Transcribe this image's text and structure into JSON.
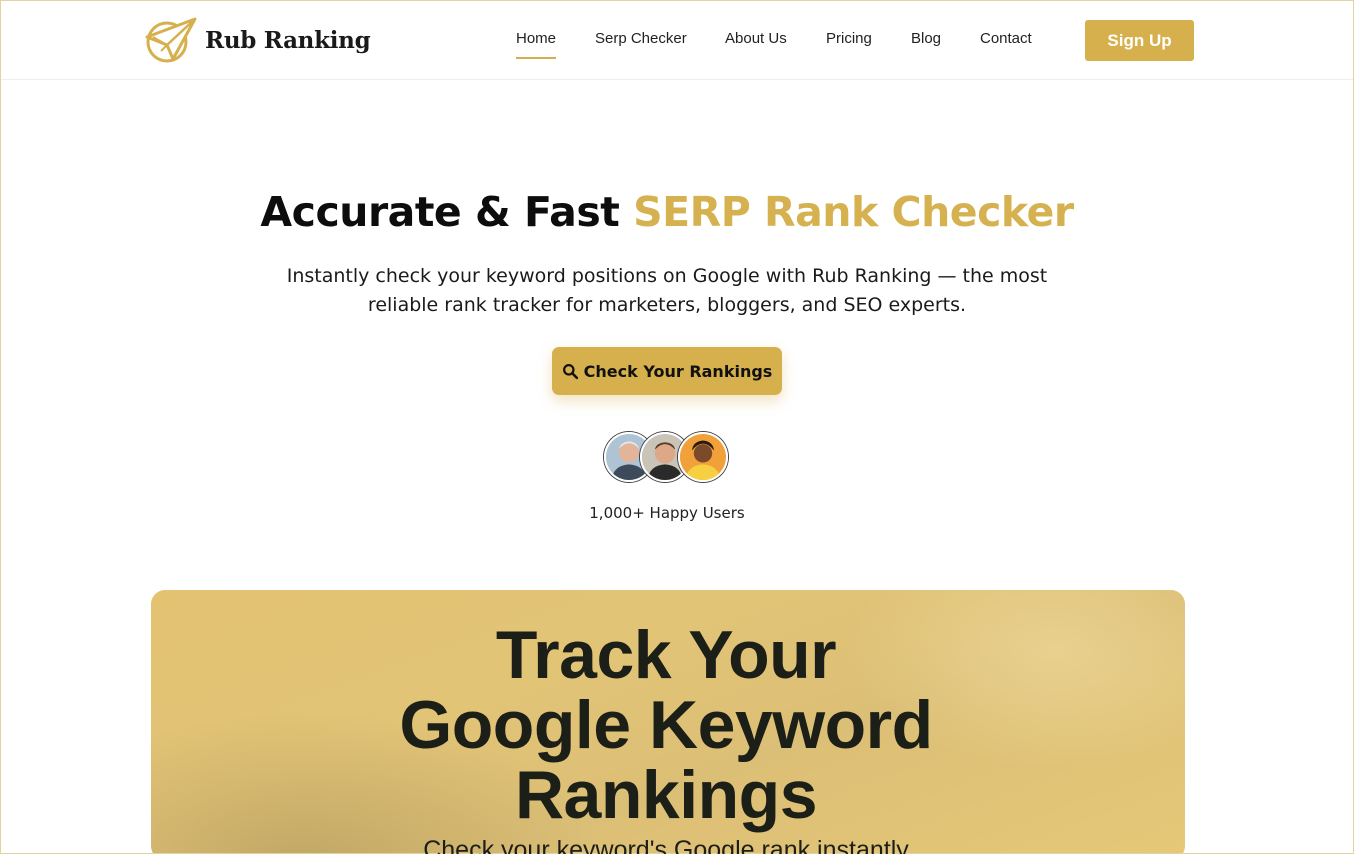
{
  "brand": {
    "name": "Rub Ranking",
    "logo_icon": "paper-plane-icon",
    "accent_color": "#d6b04c"
  },
  "nav": {
    "items": [
      {
        "label": "Home",
        "active": true
      },
      {
        "label": "Serp Checker"
      },
      {
        "label": "About Us"
      },
      {
        "label": "Pricing"
      },
      {
        "label": "Blog"
      },
      {
        "label": "Contact"
      }
    ],
    "signup_label": "Sign Up"
  },
  "hero": {
    "title_main": "Accurate & Fast ",
    "title_accent": "SERP Rank Checker",
    "subtitle_line1": "Instantly check your keyword positions on Google with Rub Ranking — the most",
    "subtitle_line2": "reliable rank tracker for marketers, bloggers, and SEO experts.",
    "cta_label": "Check Your Rankings",
    "cta_icon": "search-icon",
    "users_text": "1,000+ Happy Users"
  },
  "banner": {
    "title_line1": "Track Your",
    "title_line2": "Google Keyword",
    "title_line3": "Rankings",
    "subtitle": "Check your keyword's Google rank instantly"
  }
}
